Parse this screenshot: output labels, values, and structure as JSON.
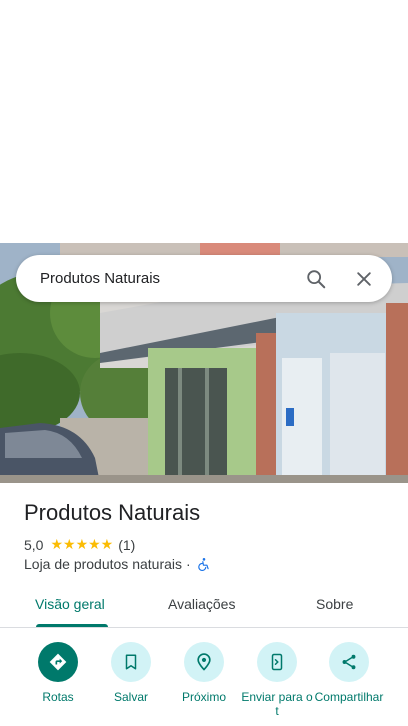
{
  "search": {
    "query": "Produtos Naturais"
  },
  "place": {
    "name": "Produtos Naturais",
    "rating": "5,0",
    "stars": "★★★★★",
    "review_count": "(1)",
    "category": "Loja de produtos naturais",
    "separator": "·"
  },
  "tabs": [
    {
      "label": "Visão geral",
      "active": true
    },
    {
      "label": "Avaliações",
      "active": false
    },
    {
      "label": "Sobre",
      "active": false
    }
  ],
  "actions": [
    {
      "label": "Rotas",
      "icon": "directions-icon"
    },
    {
      "label": "Salvar",
      "icon": "bookmark-icon"
    },
    {
      "label": "Próximo",
      "icon": "nearby-icon"
    },
    {
      "label": "Enviar para o t",
      "icon": "send-to-phone-icon"
    },
    {
      "label": "Compartilhar",
      "icon": "share-icon"
    }
  ],
  "colors": {
    "accent": "#00796b",
    "action_bg": "#d2f3f6",
    "star": "#fbbc04"
  }
}
